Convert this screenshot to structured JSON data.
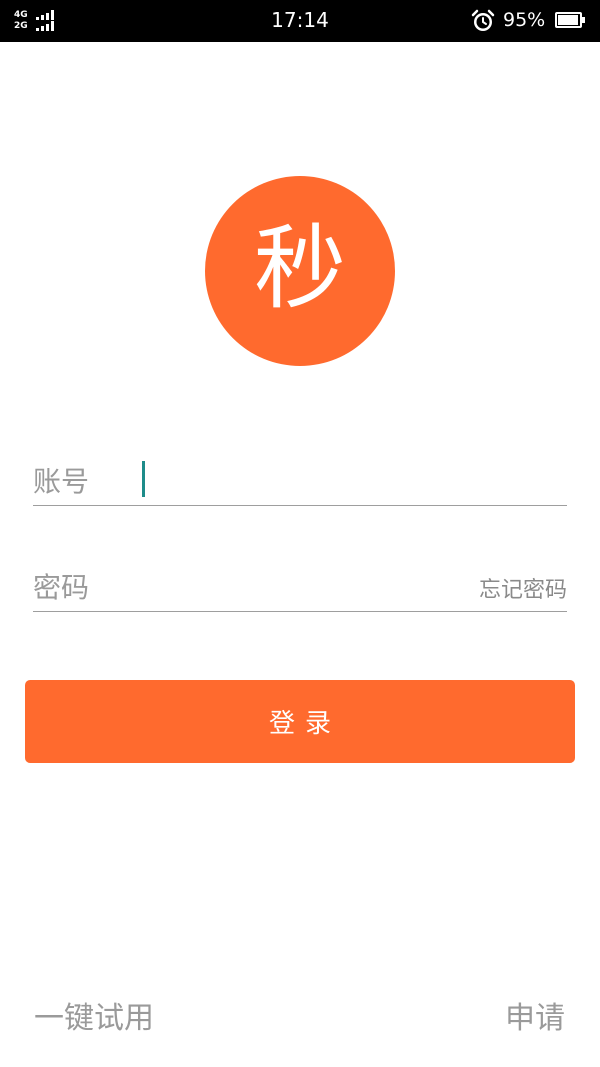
{
  "status_bar": {
    "network_top": "4G",
    "network_bottom": "2G",
    "time": "17:14",
    "battery_percent_text": "95%",
    "battery_level": 0.95,
    "icons": [
      "signal-icon",
      "alarm-icon",
      "battery-icon"
    ]
  },
  "logo": {
    "char": "秒",
    "color": "#ff6a2e"
  },
  "login_form": {
    "account_placeholder": "账号",
    "account_value": "",
    "password_placeholder": "密码",
    "password_value": "",
    "forgot_password_label": "忘记密码",
    "login_label": "登录"
  },
  "footer": {
    "trial_label": "一键试用",
    "apply_label": "申请"
  },
  "colors": {
    "accent": "#ff6a2e",
    "caret": "#1e8c8a",
    "placeholder": "#9a9a9a",
    "underline": "#9e9e9e"
  }
}
